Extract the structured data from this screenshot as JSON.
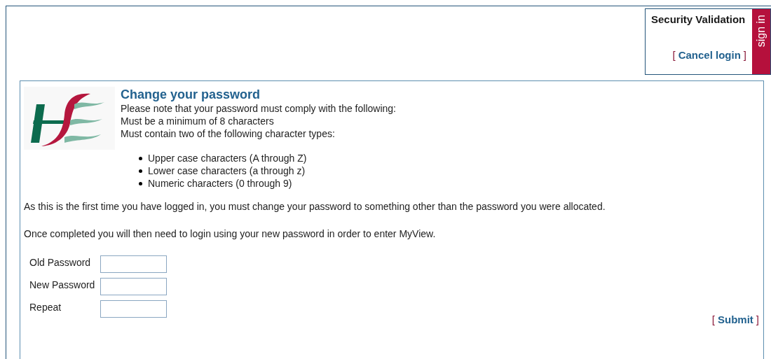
{
  "security": {
    "title": "Security Validation",
    "cancel": {
      "open": "[",
      "label": "Cancel login",
      "close": "]"
    },
    "tab": "sign in"
  },
  "panel": {
    "title": "Change your password",
    "intro": [
      "Please note that your password must comply with the following:",
      "Must be a minimum of 8 characters",
      "Must contain two of the following character types:"
    ],
    "rules": [
      "Upper case characters (A through Z)",
      "Lower case characters (a through z)",
      "Numeric characters (0 through 9)"
    ],
    "notes": [
      "As this is the first time you have logged in, you must change your password to something other than the password you were allocated.",
      "Once completed you will then need to login using your new password in order to enter MyView."
    ],
    "fields": [
      {
        "label": "Old Password"
      },
      {
        "label": "New Password"
      },
      {
        "label": "Repeat"
      }
    ],
    "submit": {
      "open": "[",
      "label": "Submit",
      "close": "]"
    }
  }
}
